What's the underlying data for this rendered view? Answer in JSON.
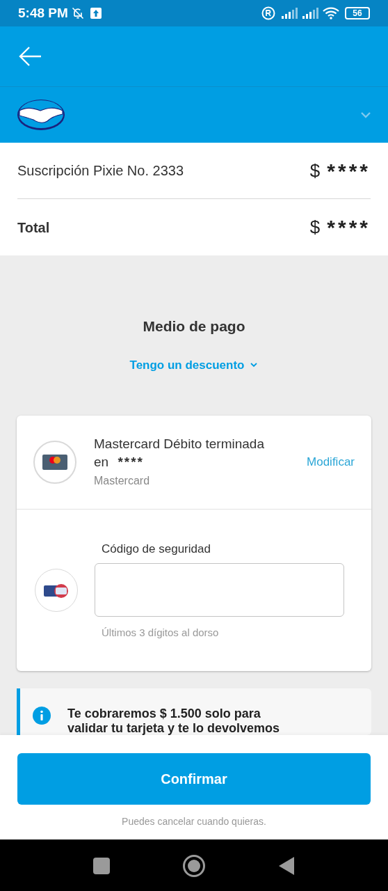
{
  "status_bar": {
    "time": "5:48 PM",
    "battery": "56"
  },
  "summary": {
    "rows": [
      {
        "label": "Suscripción Pixie No. 2333",
        "currency": "$",
        "amount": "****",
        "bold": false
      },
      {
        "label": "Total",
        "currency": "$",
        "amount": "****",
        "bold": true
      }
    ]
  },
  "payment": {
    "title": "Medio de pago",
    "discount_link": "Tengo un descuento",
    "card": {
      "name": "Mastercard Débito terminada en",
      "digits": "****",
      "brand": "Mastercard",
      "action": "Modificar"
    },
    "security": {
      "label": "Código de seguridad",
      "hint": "Últimos 3 dígitos al dorso"
    }
  },
  "info_banner": {
    "text": "Te cobraremos $ 1.500 solo para validar tu tarjeta y te lo devolvemos"
  },
  "footer": {
    "button": "Confirmar",
    "note": "Puedes cancelar cuando quieras."
  }
}
